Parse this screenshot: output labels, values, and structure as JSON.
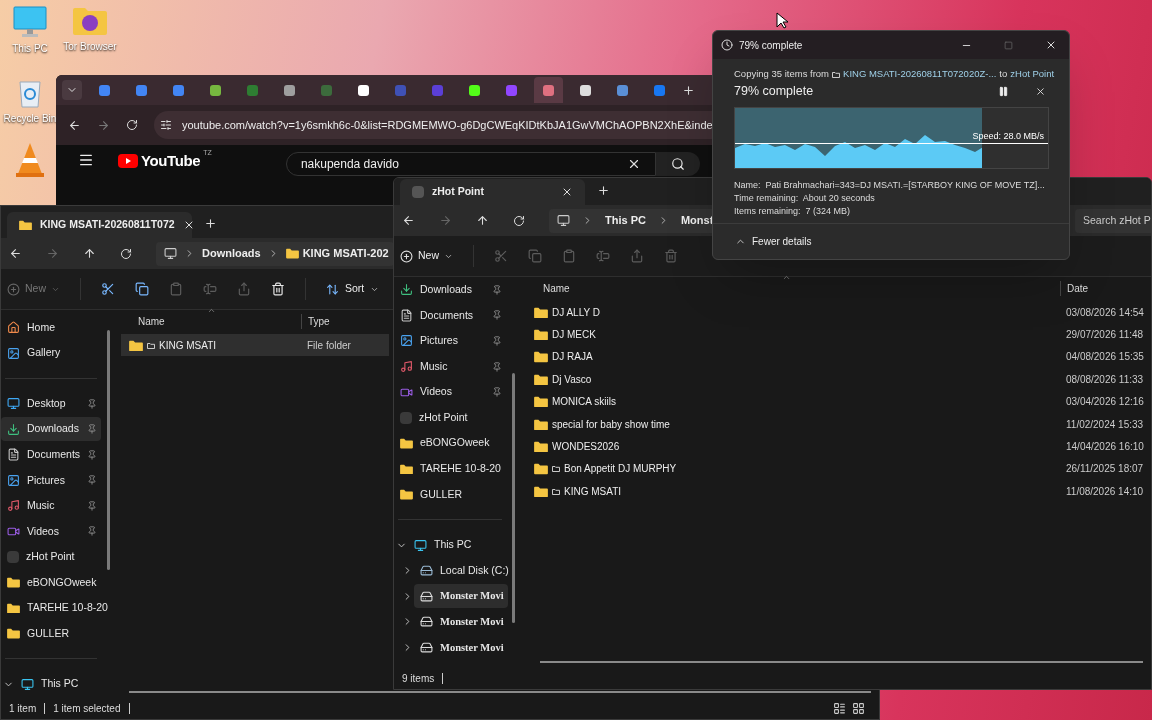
{
  "desktop": {
    "icons": [
      {
        "kind": "pc",
        "label": "This PC"
      },
      {
        "kind": "tor",
        "label": "Tor Browser"
      },
      {
        "kind": "bin",
        "label": "Recycle Bin"
      },
      {
        "kind": "vlc"
      }
    ]
  },
  "browser": {
    "tabs": [
      {
        "color": "#4285f4",
        "selected": false
      },
      {
        "color": "#4285f4",
        "selected": false
      },
      {
        "color": "#4285f4",
        "selected": false
      },
      {
        "color": "#76b83f",
        "selected": false
      },
      {
        "color": "#2e7d32",
        "selected": false
      },
      {
        "color": "#9e9e9e",
        "selected": false
      },
      {
        "color": "#3c6b3c",
        "selected": false
      },
      {
        "color": "#ffffff",
        "selected": false
      },
      {
        "color": "#3f51b5",
        "selected": false
      },
      {
        "color": "#5b3fd6",
        "selected": false
      },
      {
        "color": "#53fc18",
        "selected": false
      },
      {
        "color": "#9146ff",
        "selected": false
      },
      {
        "color": "#e07080",
        "selected": true
      },
      {
        "color": "#dddddd",
        "selected": false
      },
      {
        "color": "#5a8fd6",
        "selected": false
      },
      {
        "color": "#1877f2",
        "selected": false
      }
    ],
    "address": "youtube.com/watch?v=1y6smkh6c-0&list=RDGMEMWO-g6DgCWEqKIDtKbJA1GwVMChAOPBN2XhE&inde",
    "youtube": {
      "logo": "YouTube",
      "region": "TZ",
      "search": "nakupenda davido"
    }
  },
  "left_explorer": {
    "tab": "KING MSATI-20260811T072",
    "breadcrumb": [
      "Downloads",
      "KING MSATI-202"
    ],
    "new": {
      "label": "New",
      "disabled": true
    },
    "actions": [
      {
        "kind": "cut",
        "disabled": false
      },
      {
        "kind": "copy",
        "disabled": false
      },
      {
        "kind": "paste",
        "disabled": true
      },
      {
        "kind": "rename",
        "disabled": true
      },
      {
        "kind": "share",
        "disabled": true
      },
      {
        "kind": "delete",
        "disabled": false
      }
    ],
    "sort": "Sort",
    "sidebar": [
      {
        "items": [
          {
            "kind": "home",
            "label": "Home",
            "pinned": false,
            "selected": false
          },
          {
            "kind": "gallery",
            "label": "Gallery",
            "pinned": false,
            "selected": false
          }
        ]
      },
      {
        "items": [
          {
            "kind": "desktop",
            "label": "Desktop",
            "pinned": true,
            "selected": false
          },
          {
            "kind": "downloads",
            "label": "Downloads",
            "pinned": true,
            "selected": true
          },
          {
            "kind": "documents",
            "label": "Documents",
            "pinned": true,
            "selected": false
          },
          {
            "kind": "pictures",
            "label": "Pictures",
            "pinned": true,
            "selected": false
          },
          {
            "kind": "music",
            "label": "Music",
            "pinned": true,
            "selected": false
          },
          {
            "kind": "videos",
            "label": "Videos",
            "pinned": true,
            "selected": false
          },
          {
            "kind": "blank",
            "label": "zHot Point",
            "pinned": false,
            "selected": false
          },
          {
            "kind": "folder",
            "label": "eBONGOweek",
            "pinned": false,
            "selected": false
          },
          {
            "kind": "folder",
            "label": "TAREHE 10-8-20",
            "pinned": false,
            "selected": false
          },
          {
            "kind": "folder",
            "label": "GULLER",
            "pinned": false,
            "selected": false
          }
        ]
      },
      {
        "items": [
          {
            "kind": "pc",
            "label": "This PC",
            "expanded": true,
            "selected": false
          }
        ]
      }
    ],
    "columns": [
      "Name",
      "Type"
    ],
    "rows": [
      {
        "name": "KING MSATI",
        "glyph": true,
        "cell": "File folder",
        "selected": true
      }
    ],
    "status": [
      "1 item",
      "1 item selected"
    ]
  },
  "right_explorer": {
    "tab": "zHot Point",
    "breadcrumb": [
      "This PC",
      "Monst"
    ],
    "search": {
      "placeholder": "Search zHot P"
    },
    "new": {
      "label": "New",
      "disabled": false
    },
    "actions": [
      {
        "kind": "cut",
        "disabled": true
      },
      {
        "kind": "copy",
        "disabled": true
      },
      {
        "kind": "paste",
        "disabled": true
      },
      {
        "kind": "rename",
        "disabled": true
      },
      {
        "kind": "share",
        "disabled": true
      },
      {
        "kind": "delete",
        "disabled": true
      }
    ],
    "sidebar": [
      {
        "items": [
          {
            "kind": "downloads",
            "label": "Downloads",
            "pinned": true,
            "selected": false
          },
          {
            "kind": "documents",
            "label": "Documents",
            "pinned": true,
            "selected": false
          },
          {
            "kind": "pictures",
            "label": "Pictures",
            "pinned": true,
            "selected": false
          },
          {
            "kind": "music",
            "label": "Music",
            "pinned": true,
            "selected": false
          },
          {
            "kind": "videos",
            "label": "Videos",
            "pinned": true,
            "selected": false
          },
          {
            "kind": "blank",
            "label": "zHot Point",
            "pinned": false,
            "selected": false
          },
          {
            "kind": "folder",
            "label": "eBONGOweek",
            "pinned": false,
            "selected": false
          },
          {
            "kind": "folder",
            "label": "TAREHE 10-8-20",
            "pinned": false,
            "selected": false
          },
          {
            "kind": "folder",
            "label": "GULLER",
            "pinned": false,
            "selected": false
          }
        ]
      },
      {
        "items": [
          {
            "kind": "pc",
            "label": "This PC",
            "expanded": true,
            "selected": false,
            "children": [
              {
                "kind": "disk",
                "label": "Local Disk (C:)",
                "expanded": false,
                "selected": false
              },
              {
                "kind": "drive",
                "label": "Monster Movi",
                "expanded": false,
                "selected": true
              },
              {
                "kind": "drive",
                "label": "Monster Movi",
                "expanded": false,
                "selected": false
              },
              {
                "kind": "drive",
                "label": "Monster Movi",
                "expanded": false,
                "selected": false
              }
            ]
          }
        ]
      }
    ],
    "columns": [
      "Name",
      "Date"
    ],
    "rows": [
      {
        "name": "DJ ALLY D",
        "glyph": false,
        "cell": "03/08/2026 14:54",
        "selected": false
      },
      {
        "name": "DJ MECK",
        "glyph": false,
        "cell": "29/07/2026 11:48",
        "selected": false
      },
      {
        "name": "DJ RAJA",
        "glyph": false,
        "cell": "04/08/2026 15:35",
        "selected": false
      },
      {
        "name": "Dj Vasco",
        "glyph": false,
        "cell": "08/08/2026 11:33",
        "selected": false
      },
      {
        "name": "MONICA skiils",
        "glyph": false,
        "cell": "03/04/2026 12:16",
        "selected": false
      },
      {
        "name": "special for baby show time",
        "glyph": false,
        "cell": "11/02/2024 15:33",
        "selected": false
      },
      {
        "name": "WONDES2026",
        "glyph": false,
        "cell": "14/04/2026 16:10",
        "selected": false
      },
      {
        "name": "Bon Appetit DJ MURPHY",
        "glyph": true,
        "cell": "26/11/2025 18:07",
        "selected": false
      },
      {
        "name": "KING MSATI",
        "glyph": true,
        "cell": "11/08/2026 14:10",
        "selected": false
      }
    ],
    "status": [
      "9 items"
    ]
  },
  "copy_dialog": {
    "title": "79% complete",
    "summary": {
      "prefix": "Copying 35 items from",
      "source": "KING MSATI-20260811T072020Z-...",
      "middle": "to",
      "dest": "zHot Point"
    },
    "heading": "79% complete",
    "level": 0.79,
    "speed": "Speed: 28.0 MB/s",
    "details": [
      "Name:  Pati Brahmachari=343=DJ MSATI.=[STARBOY KING OF MOVE TZ]...",
      "Time remaining:  About 20 seconds",
      "Items remaining:  7 (324 MB)"
    ],
    "toggle": "Fewer details"
  }
}
